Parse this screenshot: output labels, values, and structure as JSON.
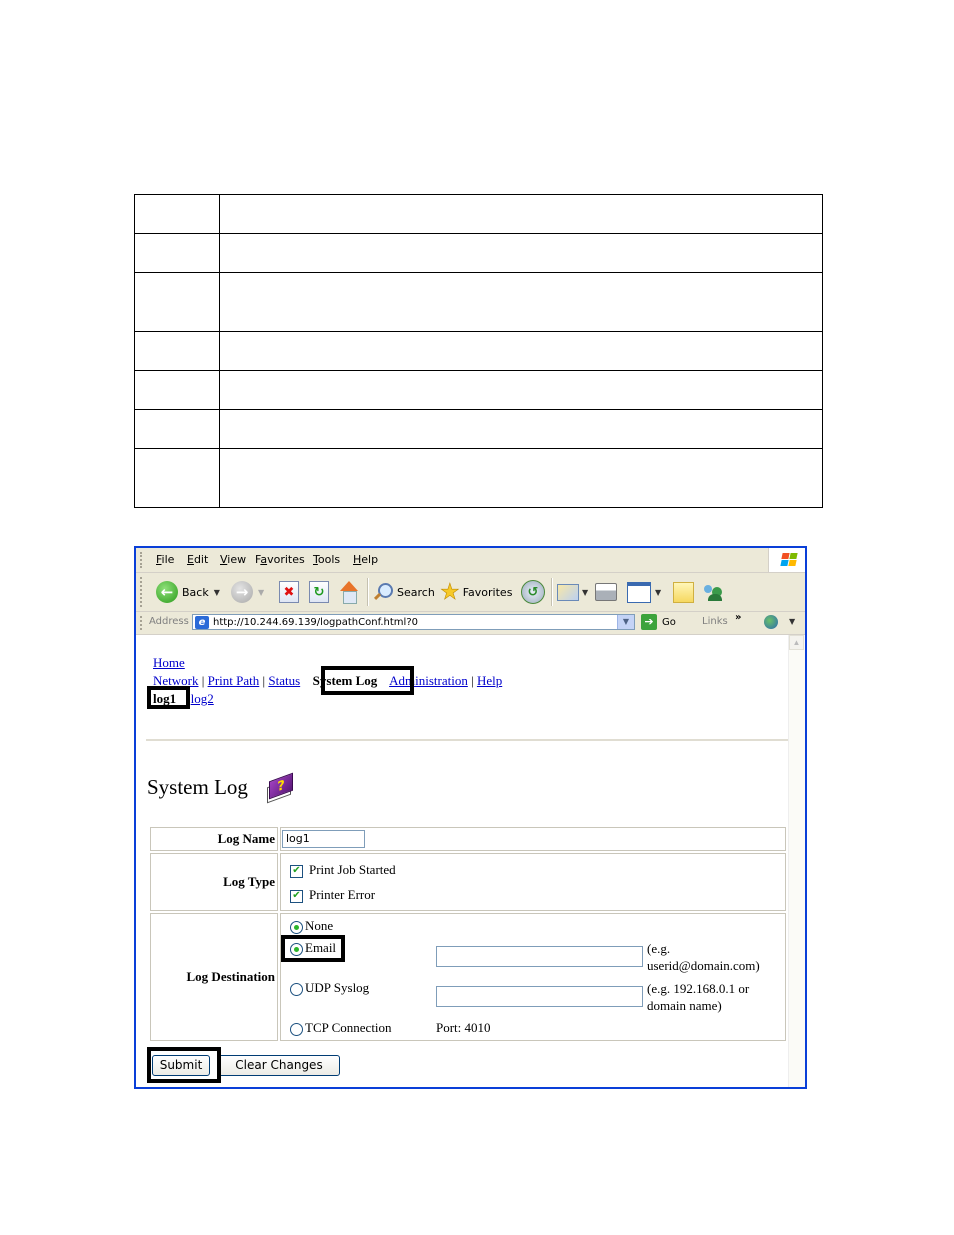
{
  "doc_table": {
    "rows": [
      {
        "c1": "",
        "c2": ""
      },
      {
        "c1": "",
        "c2": ""
      },
      {
        "c1": "",
        "c2": ""
      },
      {
        "c1": "",
        "c2": ""
      },
      {
        "c1": "",
        "c2": ""
      },
      {
        "c1": "",
        "c2": ""
      },
      {
        "c1": "",
        "c2": ""
      }
    ]
  },
  "browser": {
    "menu": [
      "File",
      "Edit",
      "View",
      "Favorites",
      "Tools",
      "Help"
    ],
    "menu_accel": [
      "F",
      "E",
      "V",
      "a",
      "T",
      "H"
    ],
    "toolbar": {
      "back_label": "Back",
      "search_label": "Search",
      "favorites_label": "Favorites"
    },
    "address": {
      "label": "Address",
      "value": "http://10.244.69.139/logpathConf.html?0",
      "go_label": "Go",
      "links_label": "Links"
    }
  },
  "page": {
    "nav": {
      "home": "Home",
      "items": [
        "Network",
        "Print Path",
        "Status",
        "System Log",
        "Administration",
        "Help"
      ],
      "current": "System Log",
      "sub_items": [
        "log1",
        "log2"
      ],
      "sub_current": "log1"
    },
    "title": "System Log",
    "form": {
      "log_name_label": "Log Name",
      "log_name_value": "log1",
      "log_type_label": "Log Type",
      "log_types": [
        {
          "label": "Print Job Started",
          "checked": true
        },
        {
          "label": "Printer Error",
          "checked": true
        }
      ],
      "log_destination_label": "Log Destination",
      "destinations": {
        "none": "None",
        "email": "Email",
        "udp": "UDP Syslog",
        "tcp": "TCP Connection"
      },
      "selected_destination": "email",
      "email_value": "",
      "email_hint_1": "(e.g.",
      "email_hint_2": "userid@domain.com)",
      "udp_value": "",
      "udp_hint_1": "(e.g. 192.168.0.1 or",
      "udp_hint_2": "domain name)",
      "tcp_port": "Port: 4010"
    },
    "buttons": {
      "submit": "Submit",
      "clear": "Clear Changes"
    }
  }
}
